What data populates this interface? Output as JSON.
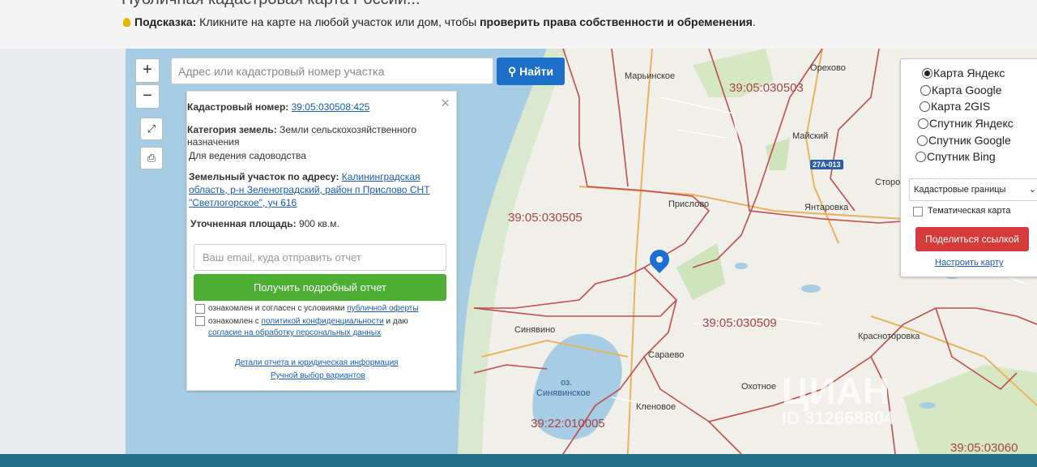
{
  "page": {
    "heading": "Публичная кадастровая карта России...",
    "hint_label": "Подсказка:",
    "hint_text": " Кликните на карте на любой участок или дом, чтобы ",
    "hint_bold": "проверить права собственности и обременения",
    "hint_end": "."
  },
  "map_controls": {
    "zoom_in": "+",
    "zoom_out": "−",
    "fullscreen": "⤢",
    "print": "⎙"
  },
  "search": {
    "placeholder": "Адрес или кадастровый номер участка",
    "button_label": "Найти"
  },
  "info_card": {
    "close": "×",
    "cadastral_label": "Кадастровый номер:",
    "cadastral_value": "39:05:030508:425",
    "category_label": "Категория земель:",
    "category_value_1": "Земли сельскохозяйственного",
    "category_value_2": "назначения",
    "usage": "Для ведения садоводства",
    "address_label": "Земельный участок по адресу:",
    "address_1": "Калининградская",
    "address_2": "область, р-н Зеленоградский, район п Прислово СНТ",
    "address_3": "\"Светлогорское\", уч 616",
    "area_label": "Уточненная площадь:",
    "area_value": "900 кв.м.",
    "email_placeholder": "Ваш email, куда отправить отчет",
    "report_button": "Получить подробный отчет",
    "agree1_text": "ознакомлен и согласен с условиями ",
    "agree1_link": "публичной оферты",
    "agree2_text": "ознакомлен с ",
    "agree2_link": "политикой конфиденциальности",
    "agree2_text2": " и даю",
    "agree2_link2": "согласие на обработку персональных данных",
    "details_link": "Детали отчета и юридическая информация",
    "manual_link": "Ручной выбор вариантов"
  },
  "layers_panel": {
    "options": [
      "Карта Яндекс",
      "Карта Google",
      "Карта 2GIS",
      "Спутник Яндекс",
      "Спутник Google",
      "Спутник Bing"
    ],
    "selected": "Карта Яндекс",
    "select_value": "Кадастровые границы",
    "thematic_label": "Тематическая карта",
    "share_button": "Поделиться ссылкой",
    "configure_link": "Настроить карту"
  },
  "map_labels": {
    "marinskoe": "Марьинское",
    "orekhovo": "Орехово",
    "maysky": "Майский",
    "storozh": "Сторож",
    "prislovo": "Прислово",
    "yantarovka": "Янтаровка",
    "sinyavino": "Синявино",
    "saraevo": "Сараево",
    "krasnotorovka": "Красноторовка",
    "okhotnoe": "Охотное",
    "klenovoe": "Кленовое",
    "lake_1": "оз.",
    "lake_2": "Синявинское",
    "road": "27А-013",
    "cad_1": "39:05:030503",
    "cad_2": "39:05:030505",
    "cad_3": "39:05:030509",
    "cad_4": "39:22:010005",
    "cad_5": "39:05:03060"
  },
  "watermark": {
    "logo": "ЦИАН",
    "id": "ID 312668804"
  }
}
